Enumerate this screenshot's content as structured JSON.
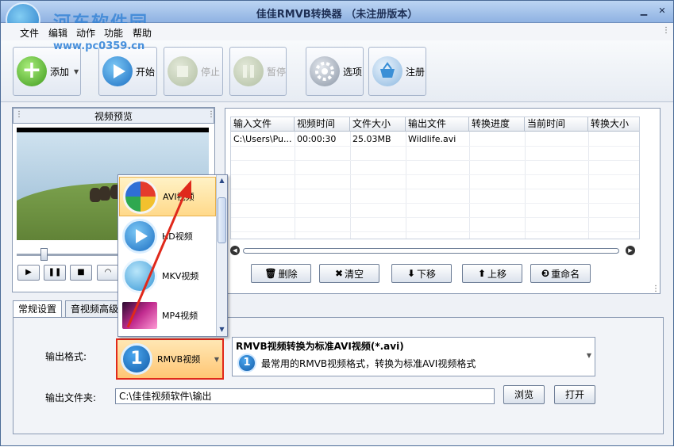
{
  "window": {
    "title": "佳佳RMVB转换器  （未注册版本）"
  },
  "watermark": {
    "brand": "河东软件园",
    "url": "www.pc0359.cn"
  },
  "menu": [
    "文件",
    "编辑",
    "动作",
    "功能",
    "帮助"
  ],
  "toolbar": {
    "add": "添加",
    "start": "开始",
    "stop": "停止",
    "pause": "暂停",
    "options": "选项",
    "register": "注册"
  },
  "preview": {
    "title": "视频预览"
  },
  "file_list": {
    "columns": [
      "输入文件",
      "视频时间",
      "文件大小",
      "输出文件",
      "转换进度",
      "当前时间",
      "转换大小"
    ],
    "rows": [
      {
        "input": "C:\\Users\\Pu...",
        "duration": "00:00:30",
        "size": "25.03MB",
        "output": "Wildlife.avi",
        "progress": "",
        "current": "",
        "converted": ""
      }
    ]
  },
  "list_actions": {
    "delete": "删除",
    "clear": "清空",
    "down": "下移",
    "up": "上移",
    "rename": "重命名"
  },
  "tabs": [
    "常规设置",
    "音视频高级"
  ],
  "settings": {
    "format_label": "输出格式:",
    "format_value": "RMVB视频",
    "format_number": "1",
    "format_title": "RMVB视频转换为标准AVI视频(*.avi)",
    "format_desc": "最常用的RMVB视频格式，转换为标准AVI视频格式",
    "folder_label": "输出文件夹:",
    "folder_value": "C:\\佳佳视频软件\\输出",
    "browse": "浏览",
    "open": "打开"
  },
  "format_dropdown": {
    "items": [
      {
        "label": "AVI视频",
        "icon": "avi-format-icon",
        "selected": true
      },
      {
        "label": "HD视频",
        "icon": "hd-format-icon",
        "selected": false
      },
      {
        "label": "MKV视频",
        "icon": "mkv-format-icon",
        "selected": false
      },
      {
        "label": "MP4视频",
        "icon": "mp4-format-icon",
        "selected": false
      }
    ]
  },
  "colors": {
    "highlight_border": "#e0291b",
    "selection_bg": "#ffd98a",
    "title_gradient_top": "#bcd5f3"
  }
}
